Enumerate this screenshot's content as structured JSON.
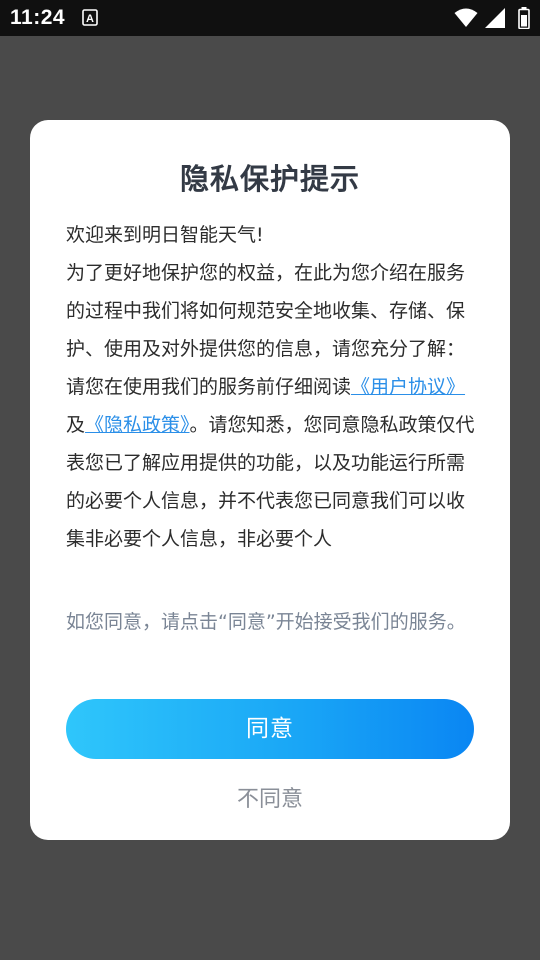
{
  "status_bar": {
    "time": "11:24",
    "notification_icon": "a-letter-icon",
    "icons": [
      "wifi-icon",
      "signal-icon",
      "battery-icon"
    ]
  },
  "dialog": {
    "title": "隐私保护提示",
    "greeting": "欢迎来到明日智能天气!",
    "intro": "为了更好地保护您的权益，在此为您介绍在服务的过程中我们将如何规范安全地收集、存储、保护、使用及对外提供您的信息，请您充分了解：",
    "read_prefix": "请您在使用我们的服务前仔细阅读",
    "user_agreement_link": "《用户协议》",
    "conjunction": "及",
    "privacy_policy_link": "《隐私政策》",
    "read_suffix": "。请您知悉，您同意隐私政策仅代表您已了解应用提供的功能，以及功能运行所需的必要个人信息，并不代表您已同意我们可以收集非必要个人信息，非必要个人",
    "consent_note": "如您同意，请点击“同意”开始接受我们的服务。",
    "agree_label": "同意",
    "disagree_label": "不同意"
  },
  "colors": {
    "overlay": "#4a4a4a",
    "status_bar": "#101010",
    "link": "#2b8fe8",
    "button_gradient_start": "#2fc6fb",
    "button_gradient_end": "#0a86f3",
    "note_text": "#7a8595"
  }
}
